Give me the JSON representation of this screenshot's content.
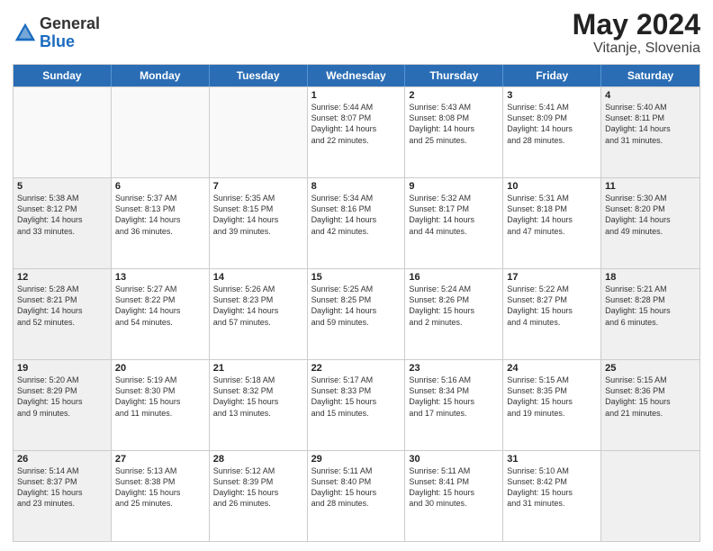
{
  "header": {
    "logo_general": "General",
    "logo_blue": "Blue",
    "month_year": "May 2024",
    "location": "Vitanje, Slovenia"
  },
  "weekdays": [
    "Sunday",
    "Monday",
    "Tuesday",
    "Wednesday",
    "Thursday",
    "Friday",
    "Saturday"
  ],
  "rows": [
    [
      {
        "day": "",
        "info": "",
        "shaded": false,
        "empty": true
      },
      {
        "day": "",
        "info": "",
        "shaded": false,
        "empty": true
      },
      {
        "day": "",
        "info": "",
        "shaded": false,
        "empty": true
      },
      {
        "day": "1",
        "info": "Sunrise: 5:44 AM\nSunset: 8:07 PM\nDaylight: 14 hours\nand 22 minutes.",
        "shaded": false,
        "empty": false
      },
      {
        "day": "2",
        "info": "Sunrise: 5:43 AM\nSunset: 8:08 PM\nDaylight: 14 hours\nand 25 minutes.",
        "shaded": false,
        "empty": false
      },
      {
        "day": "3",
        "info": "Sunrise: 5:41 AM\nSunset: 8:09 PM\nDaylight: 14 hours\nand 28 minutes.",
        "shaded": false,
        "empty": false
      },
      {
        "day": "4",
        "info": "Sunrise: 5:40 AM\nSunset: 8:11 PM\nDaylight: 14 hours\nand 31 minutes.",
        "shaded": true,
        "empty": false
      }
    ],
    [
      {
        "day": "5",
        "info": "Sunrise: 5:38 AM\nSunset: 8:12 PM\nDaylight: 14 hours\nand 33 minutes.",
        "shaded": true,
        "empty": false
      },
      {
        "day": "6",
        "info": "Sunrise: 5:37 AM\nSunset: 8:13 PM\nDaylight: 14 hours\nand 36 minutes.",
        "shaded": false,
        "empty": false
      },
      {
        "day": "7",
        "info": "Sunrise: 5:35 AM\nSunset: 8:15 PM\nDaylight: 14 hours\nand 39 minutes.",
        "shaded": false,
        "empty": false
      },
      {
        "day": "8",
        "info": "Sunrise: 5:34 AM\nSunset: 8:16 PM\nDaylight: 14 hours\nand 42 minutes.",
        "shaded": false,
        "empty": false
      },
      {
        "day": "9",
        "info": "Sunrise: 5:32 AM\nSunset: 8:17 PM\nDaylight: 14 hours\nand 44 minutes.",
        "shaded": false,
        "empty": false
      },
      {
        "day": "10",
        "info": "Sunrise: 5:31 AM\nSunset: 8:18 PM\nDaylight: 14 hours\nand 47 minutes.",
        "shaded": false,
        "empty": false
      },
      {
        "day": "11",
        "info": "Sunrise: 5:30 AM\nSunset: 8:20 PM\nDaylight: 14 hours\nand 49 minutes.",
        "shaded": true,
        "empty": false
      }
    ],
    [
      {
        "day": "12",
        "info": "Sunrise: 5:28 AM\nSunset: 8:21 PM\nDaylight: 14 hours\nand 52 minutes.",
        "shaded": true,
        "empty": false
      },
      {
        "day": "13",
        "info": "Sunrise: 5:27 AM\nSunset: 8:22 PM\nDaylight: 14 hours\nand 54 minutes.",
        "shaded": false,
        "empty": false
      },
      {
        "day": "14",
        "info": "Sunrise: 5:26 AM\nSunset: 8:23 PM\nDaylight: 14 hours\nand 57 minutes.",
        "shaded": false,
        "empty": false
      },
      {
        "day": "15",
        "info": "Sunrise: 5:25 AM\nSunset: 8:25 PM\nDaylight: 14 hours\nand 59 minutes.",
        "shaded": false,
        "empty": false
      },
      {
        "day": "16",
        "info": "Sunrise: 5:24 AM\nSunset: 8:26 PM\nDaylight: 15 hours\nand 2 minutes.",
        "shaded": false,
        "empty": false
      },
      {
        "day": "17",
        "info": "Sunrise: 5:22 AM\nSunset: 8:27 PM\nDaylight: 15 hours\nand 4 minutes.",
        "shaded": false,
        "empty": false
      },
      {
        "day": "18",
        "info": "Sunrise: 5:21 AM\nSunset: 8:28 PM\nDaylight: 15 hours\nand 6 minutes.",
        "shaded": true,
        "empty": false
      }
    ],
    [
      {
        "day": "19",
        "info": "Sunrise: 5:20 AM\nSunset: 8:29 PM\nDaylight: 15 hours\nand 9 minutes.",
        "shaded": true,
        "empty": false
      },
      {
        "day": "20",
        "info": "Sunrise: 5:19 AM\nSunset: 8:30 PM\nDaylight: 15 hours\nand 11 minutes.",
        "shaded": false,
        "empty": false
      },
      {
        "day": "21",
        "info": "Sunrise: 5:18 AM\nSunset: 8:32 PM\nDaylight: 15 hours\nand 13 minutes.",
        "shaded": false,
        "empty": false
      },
      {
        "day": "22",
        "info": "Sunrise: 5:17 AM\nSunset: 8:33 PM\nDaylight: 15 hours\nand 15 minutes.",
        "shaded": false,
        "empty": false
      },
      {
        "day": "23",
        "info": "Sunrise: 5:16 AM\nSunset: 8:34 PM\nDaylight: 15 hours\nand 17 minutes.",
        "shaded": false,
        "empty": false
      },
      {
        "day": "24",
        "info": "Sunrise: 5:15 AM\nSunset: 8:35 PM\nDaylight: 15 hours\nand 19 minutes.",
        "shaded": false,
        "empty": false
      },
      {
        "day": "25",
        "info": "Sunrise: 5:15 AM\nSunset: 8:36 PM\nDaylight: 15 hours\nand 21 minutes.",
        "shaded": true,
        "empty": false
      }
    ],
    [
      {
        "day": "26",
        "info": "Sunrise: 5:14 AM\nSunset: 8:37 PM\nDaylight: 15 hours\nand 23 minutes.",
        "shaded": true,
        "empty": false
      },
      {
        "day": "27",
        "info": "Sunrise: 5:13 AM\nSunset: 8:38 PM\nDaylight: 15 hours\nand 25 minutes.",
        "shaded": false,
        "empty": false
      },
      {
        "day": "28",
        "info": "Sunrise: 5:12 AM\nSunset: 8:39 PM\nDaylight: 15 hours\nand 26 minutes.",
        "shaded": false,
        "empty": false
      },
      {
        "day": "29",
        "info": "Sunrise: 5:11 AM\nSunset: 8:40 PM\nDaylight: 15 hours\nand 28 minutes.",
        "shaded": false,
        "empty": false
      },
      {
        "day": "30",
        "info": "Sunrise: 5:11 AM\nSunset: 8:41 PM\nDaylight: 15 hours\nand 30 minutes.",
        "shaded": false,
        "empty": false
      },
      {
        "day": "31",
        "info": "Sunrise: 5:10 AM\nSunset: 8:42 PM\nDaylight: 15 hours\nand 31 minutes.",
        "shaded": false,
        "empty": false
      },
      {
        "day": "",
        "info": "",
        "shaded": true,
        "empty": true
      }
    ]
  ]
}
